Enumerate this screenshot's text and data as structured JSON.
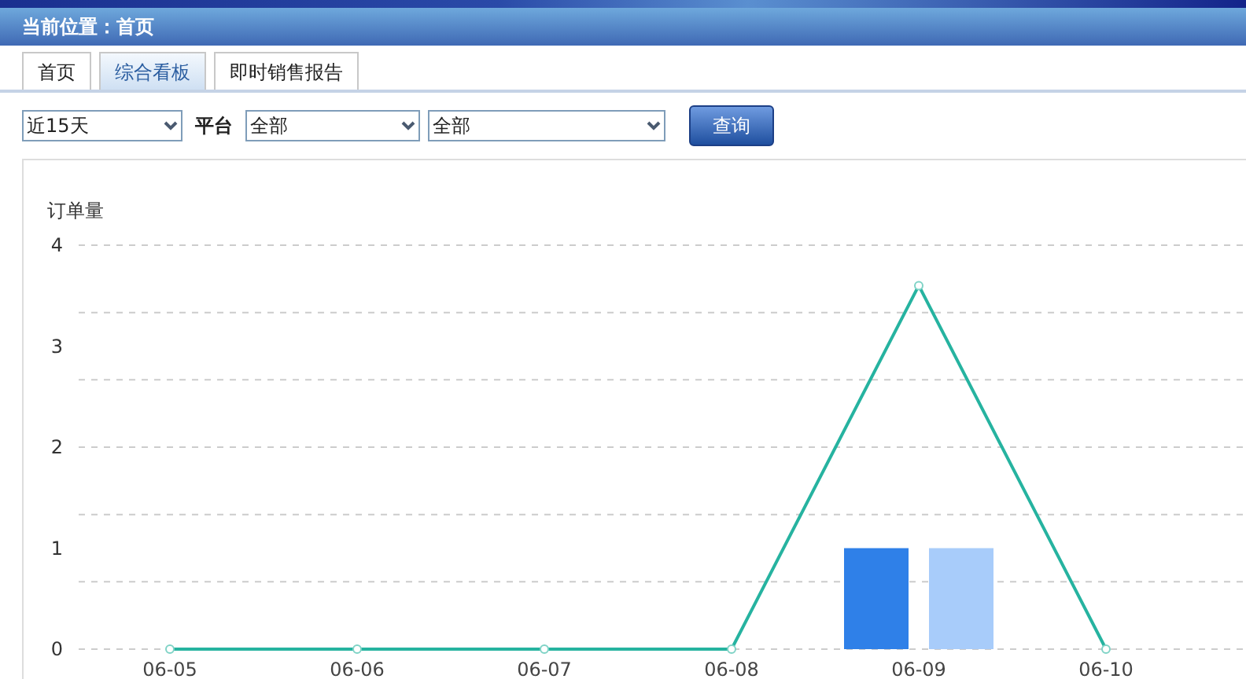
{
  "breadcrumb": "当前位置：首页",
  "tabs": [
    {
      "label": "首页",
      "selected": false
    },
    {
      "label": "综合看板",
      "selected": true
    },
    {
      "label": "即时销售报告",
      "selected": false
    }
  ],
  "filters": [
    {
      "kind": "select",
      "value": "近15天"
    },
    {
      "kind": "label",
      "text": "平台"
    },
    {
      "kind": "select",
      "value": "全部"
    },
    {
      "kind": "select",
      "value": "全部"
    }
  ],
  "query_button": "查询",
  "chart": {
    "chart_data": {
      "type": "line",
      "ylabel": "订单量",
      "categories": [
        "06-05",
        "06-06",
        "06-07",
        "06-08",
        "06-09",
        "06-10"
      ],
      "ylim": [
        0,
        4
      ],
      "yticks": [
        0,
        1,
        2,
        3,
        4
      ],
      "series": [
        {
          "marker": true,
          "color": "#26b3a0",
          "values": [
            0,
            0,
            0,
            0,
            3.6,
            0
          ]
        },
        {
          "type": "bar",
          "color": "#2f80e8",
          "values": [
            null,
            null,
            null,
            null,
            1,
            null
          ]
        },
        {
          "type": "bar",
          "color": "#a8ccfa",
          "values": [
            null,
            null,
            null,
            null,
            1,
            null
          ]
        }
      ]
    }
  }
}
